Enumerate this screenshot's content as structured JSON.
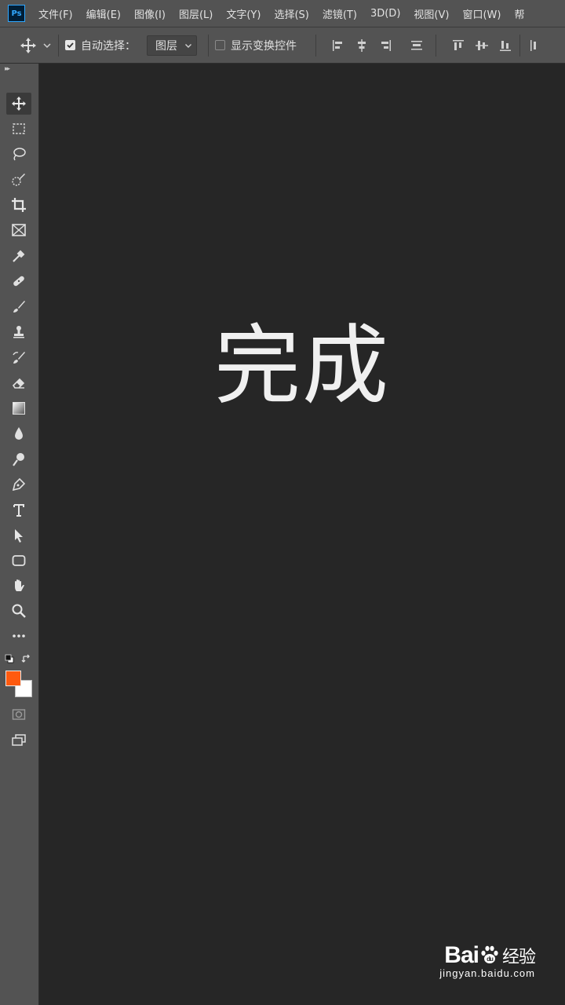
{
  "app": {
    "logo_text": "Ps"
  },
  "menu": [
    "文件(F)",
    "编辑(E)",
    "图像(I)",
    "图层(L)",
    "文字(Y)",
    "选择(S)",
    "滤镜(T)",
    "3D(D)",
    "视图(V)",
    "窗口(W)",
    "帮"
  ],
  "options": {
    "auto_select_label": "自动选择：",
    "auto_select_checked": true,
    "layer_select_value": "图层",
    "show_transform_label": "显示变换控件",
    "show_transform_checked": false
  },
  "canvas": {
    "text": "完成"
  },
  "colors": {
    "foreground": "#ff5a0f",
    "background": "#ffffff",
    "ui_panel": "#535353",
    "canvas_bg": "#262626"
  },
  "tools": [
    "move-tool",
    "marquee-tool",
    "lasso-tool",
    "quick-select-tool",
    "crop-tool",
    "frame-tool",
    "eyedropper-tool",
    "healing-brush-tool",
    "brush-tool",
    "clone-stamp-tool",
    "history-brush-tool",
    "eraser-tool",
    "gradient-tool",
    "blur-tool",
    "dodge-tool",
    "pen-tool",
    "type-tool",
    "path-select-tool",
    "rectangle-tool",
    "hand-tool",
    "zoom-tool",
    "more-tools",
    "quick-mask",
    "screen-mode"
  ],
  "watermark": {
    "brand_left": "Bai",
    "brand_right": "经验",
    "url": "jingyan.baidu.com"
  }
}
